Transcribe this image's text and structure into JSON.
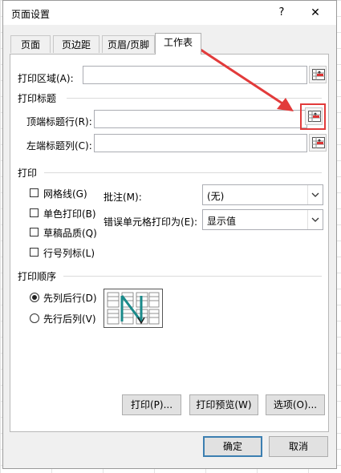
{
  "dialog": {
    "title": "页面设置",
    "help": "?",
    "close": "✕"
  },
  "tabs": [
    "页面",
    "页边距",
    "页眉/页脚",
    "工作表"
  ],
  "print_area": {
    "label": "打印区域(A):"
  },
  "print_titles": {
    "heading": "打印标题",
    "rows_label": "顶端标题行(R):",
    "cols_label": "左端标题列(C):"
  },
  "print": {
    "heading": "打印",
    "checkboxes": [
      "网格线(G)",
      "单色打印(B)",
      "草稿品质(Q)",
      "行号列标(L)"
    ],
    "comments_label": "批注(M):",
    "comments_value": "(无)",
    "errors_label": "错误单元格打印为(E):",
    "errors_value": "显示值"
  },
  "order": {
    "heading": "打印顺序",
    "options": [
      "先列后行(D)",
      "先行后列(V)"
    ],
    "selected": 0
  },
  "buttons": {
    "print": "打印(P)...",
    "preview": "打印预览(W)",
    "options": "选项(O)...",
    "ok": "确定",
    "cancel": "取消"
  },
  "colors": {
    "highlight": "#e23b3b",
    "order_arrow": "#1a8a8a"
  }
}
